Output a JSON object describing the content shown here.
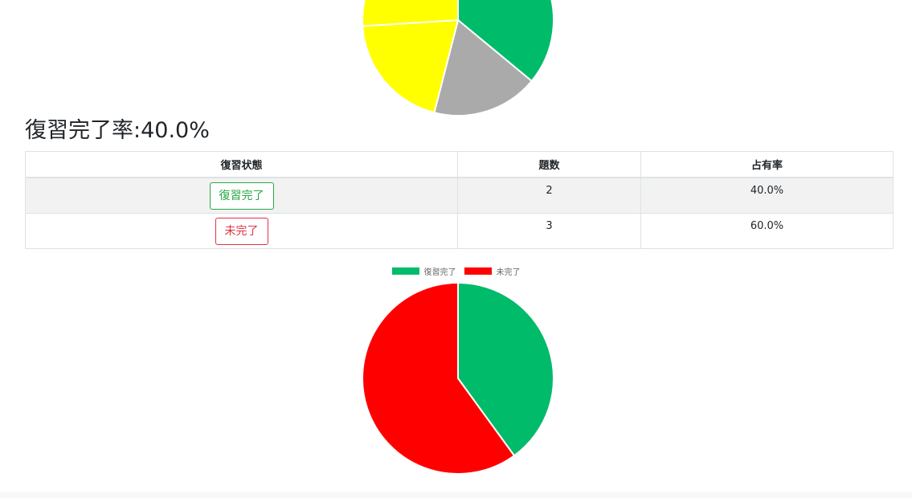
{
  "summary": {
    "heading_label": "復習完了率:",
    "heading_value": "40.0%"
  },
  "table": {
    "headers": [
      "復習状態",
      "題数",
      "占有率"
    ],
    "rows": [
      {
        "status": "復習完了",
        "count": "2",
        "share": "40.0%"
      },
      {
        "status": "未完了",
        "count": "3",
        "share": "60.0%"
      }
    ]
  },
  "chart_data": [
    {
      "type": "pie",
      "categories": [],
      "values": [
        36,
        18,
        20,
        26
      ],
      "colors": [
        "#00bb6a",
        "#aaaaaa",
        "#ffff00",
        "#ffff00"
      ],
      "note_cropped": true
    },
    {
      "type": "pie",
      "categories": [
        "復習完了",
        "未完了"
      ],
      "values": [
        2,
        3
      ],
      "colors": [
        "#00bb6a",
        "#ff0000"
      ],
      "legend": "top"
    }
  ]
}
